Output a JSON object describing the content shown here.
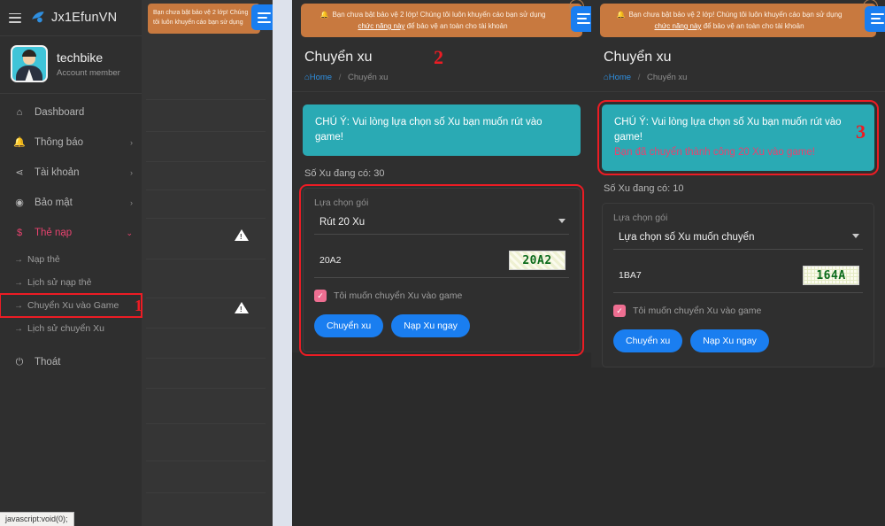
{
  "statusbar": {
    "url": "javascript:void(0);"
  },
  "sidebar": {
    "brand": "Jx1EfunVN",
    "user": {
      "name": "techbike",
      "role": "Account member"
    },
    "nav": [
      {
        "label": "Dashboard",
        "icon": "home-icon",
        "caret": ""
      },
      {
        "label": "Thông báo",
        "icon": "bell-icon",
        "caret": "›"
      },
      {
        "label": "Tài khoản",
        "icon": "share-icon",
        "caret": "›"
      },
      {
        "label": "Bảo mật",
        "icon": "shield-icon",
        "caret": "›"
      },
      {
        "label": "Thẻ nạp",
        "icon": "dollar-icon",
        "caret": "⌄"
      }
    ],
    "sub": [
      {
        "label": "Nạp thẻ"
      },
      {
        "label": "Lịch sử nạp thẻ"
      },
      {
        "label": "Chuyển Xu vào Game"
      },
      {
        "label": "Lịch sử chuyển Xu"
      }
    ],
    "logout": {
      "label": "Thoát",
      "icon": "power-icon"
    }
  },
  "markers": {
    "one": "1",
    "two": "2",
    "three": "3"
  },
  "warning_banner": {
    "text_before": "Bạn chưa bật bảo vệ 2 lớp! Chúng tôi luôn khuyến cáo bạn sử dụng ",
    "link": "chức năng này",
    "text_after": " để bảo vệ an toàn cho tài khoản",
    "icon": "bell-icon"
  },
  "page": {
    "title": "Chuyển xu",
    "breadcrumb": {
      "home": "Home",
      "separator": "/",
      "current": "Chuyển xu"
    }
  },
  "panel_mid": {
    "notice": "CHÚ Ý: Vui lòng lựa chọn số Xu bạn muốn rút vào game!",
    "notice_success": "",
    "balance": "Số Xu đang có: 30",
    "form": {
      "label": "Lựa chọn gói",
      "select_value": "Rút 20 Xu",
      "captcha_value": "20A2",
      "captcha_image": "20A2",
      "checkbox_label": "Tôi muốn chuyển Xu vào game",
      "checkbox_mark": "✓",
      "btn_primary": "Chuyển xu",
      "btn_secondary": "Nạp Xu ngay"
    }
  },
  "panel_right": {
    "notice": "CHÚ Ý: Vui lòng lựa chọn số Xu bạn muốn rút vào game!",
    "notice_success": "Bạn đã chuyển thành công 20 Xu vào game!",
    "balance": "Số Xu đang có: 10",
    "form": {
      "label": "Lựa chọn gói",
      "select_value": "Lựa chọn số Xu muốn chuyển",
      "captcha_value": "1BA7",
      "captcha_image": "164A",
      "checkbox_label": "Tôi muốn chuyển Xu vào game",
      "checkbox_mark": "✓",
      "btn_primary": "Chuyển xu",
      "btn_secondary": "Nạp Xu ngay"
    }
  },
  "colors": {
    "accent_blue": "#1a7ef0",
    "warn_orange": "#c8793f",
    "teal_notice": "#2aaab4",
    "pink_accent": "#e8436f",
    "marker_red": "#ec1c24"
  }
}
